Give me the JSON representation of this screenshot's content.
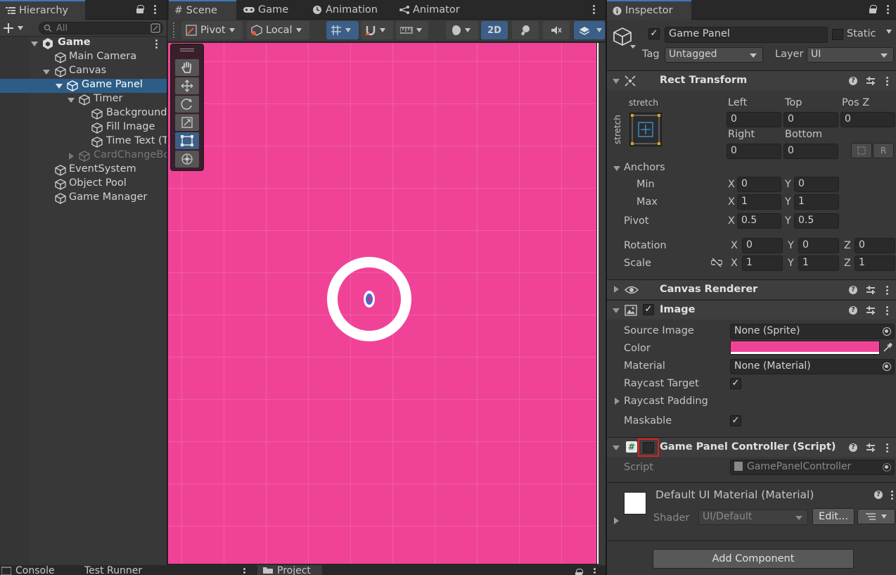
{
  "colors": {
    "scene_bg": "#f04397",
    "selection": "#2c5d87",
    "highlight_box": "#e02020"
  },
  "hierarchy": {
    "tab": "Hierarchy",
    "search_placeholder": "All",
    "scene_name": "Game",
    "items": [
      {
        "label": "Main Camera"
      },
      {
        "label": "Canvas"
      },
      {
        "label": "Game Panel"
      },
      {
        "label": "Timer"
      },
      {
        "label": "Background"
      },
      {
        "label": "Fill Image"
      },
      {
        "label": "Time Text (T"
      },
      {
        "label": "CardChangeBo"
      },
      {
        "label": "EventSystem"
      },
      {
        "label": "Object Pool"
      },
      {
        "label": "Game Manager"
      }
    ]
  },
  "scene_tabs": {
    "scene": "Scene",
    "game": "Game",
    "animation": "Animation",
    "animator": "Animator"
  },
  "scene_toolbar": {
    "pivot": "Pivot",
    "local": "Local",
    "mode_2d": "2D"
  },
  "bottom_tabs": {
    "console": "Console",
    "test_runner": "Test Runner",
    "project": "Project"
  },
  "inspector": {
    "tab": "Inspector",
    "object_name": "Game Panel",
    "static_label": "Static",
    "tag_label": "Tag",
    "tag_value": "Untagged",
    "layer_label": "Layer",
    "layer_value": "UI",
    "rect_transform": {
      "title": "Rect Transform",
      "anchor_preset_h": "stretch",
      "anchor_preset_v": "stretch",
      "left_label": "Left",
      "left": "0",
      "top_label": "Top",
      "top": "0",
      "posz_label": "Pos Z",
      "posz": "0",
      "right_label": "Right",
      "right": "0",
      "bottom_label": "Bottom",
      "bottom": "0",
      "blueprint_btn": "R",
      "anchors_label": "Anchors",
      "min_label": "Min",
      "min_x": "0",
      "min_y": "0",
      "max_label": "Max",
      "max_x": "1",
      "max_y": "1",
      "pivot_label": "Pivot",
      "pivot_x": "0.5",
      "pivot_y": "0.5",
      "rotation_label": "Rotation",
      "rot_x": "0",
      "rot_y": "0",
      "rot_z": "0",
      "scale_label": "Scale",
      "scale_x": "1",
      "scale_y": "1",
      "scale_z": "1",
      "x": "X",
      "y": "Y",
      "z": "Z"
    },
    "canvas_renderer": {
      "title": "Canvas Renderer"
    },
    "image": {
      "title": "Image",
      "source_label": "Source Image",
      "source_value": "None (Sprite)",
      "color_label": "Color",
      "color_value": "#f04397",
      "material_label": "Material",
      "material_value": "None (Material)",
      "raycast_target_label": "Raycast Target",
      "raycast_padding_label": "Raycast Padding",
      "maskable_label": "Maskable"
    },
    "script_component": {
      "title": "Game Panel Controller (Script)",
      "script_label": "Script",
      "script_value": "GamePanelController"
    },
    "material_preview": {
      "title": "Default UI Material (Material)",
      "shader_label": "Shader",
      "shader_value": "UI/Default",
      "edit_button": "Edit..."
    },
    "add_component": "Add Component"
  }
}
